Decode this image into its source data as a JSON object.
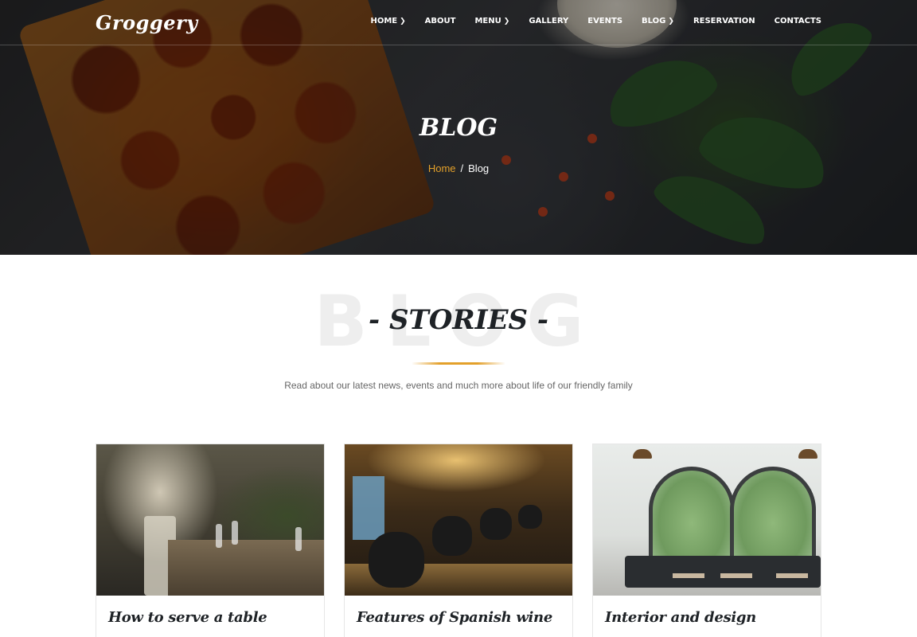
{
  "brand": {
    "logo_text": "Groggery"
  },
  "nav": {
    "items": [
      {
        "label": "HOME",
        "has_dropdown": true
      },
      {
        "label": "ABOUT",
        "has_dropdown": false
      },
      {
        "label": "MENU",
        "has_dropdown": true
      },
      {
        "label": "GALLERY",
        "has_dropdown": false
      },
      {
        "label": "EVENTS",
        "has_dropdown": false
      },
      {
        "label": "BLOG",
        "has_dropdown": true
      },
      {
        "label": "RESERVATION",
        "has_dropdown": false
      },
      {
        "label": "CONTACTS",
        "has_dropdown": false
      }
    ],
    "caret_icon": "chevron-down-icon"
  },
  "hero": {
    "title": "BLOG",
    "breadcrumb": {
      "home": "Home",
      "separator": "/",
      "current": "Blog"
    }
  },
  "section": {
    "background_word": "BLOG",
    "title": "- STORIES -",
    "subtitle": "Read about our latest news, events and much more about life of our friendly family"
  },
  "cards": [
    {
      "title": "How to serve a table"
    },
    {
      "title": "Features of Spanish wine"
    },
    {
      "title": "Interior and design"
    }
  ],
  "colors": {
    "accent": "#e3a02a",
    "heading": "#1e2226",
    "text_muted": "#666666"
  }
}
